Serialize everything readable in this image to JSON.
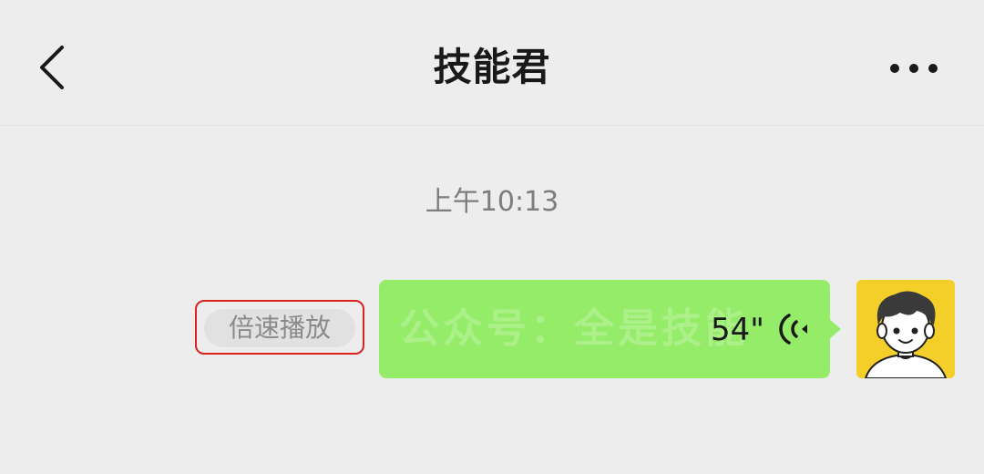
{
  "header": {
    "title": "技能君"
  },
  "chat": {
    "timestamp": "上午10:13",
    "voice_message": {
      "duration": "54\"",
      "watermark": "公众号：全是技能",
      "speed_label": "倍速播放"
    }
  },
  "colors": {
    "background": "#ededed",
    "bubble_green": "#95ec69",
    "highlight_red": "#d9241f",
    "avatar_yellow": "#f4cf2a"
  },
  "icons": [
    "back-arrow-icon",
    "more-dots-icon",
    "voice-wave-icon",
    "avatar"
  ]
}
